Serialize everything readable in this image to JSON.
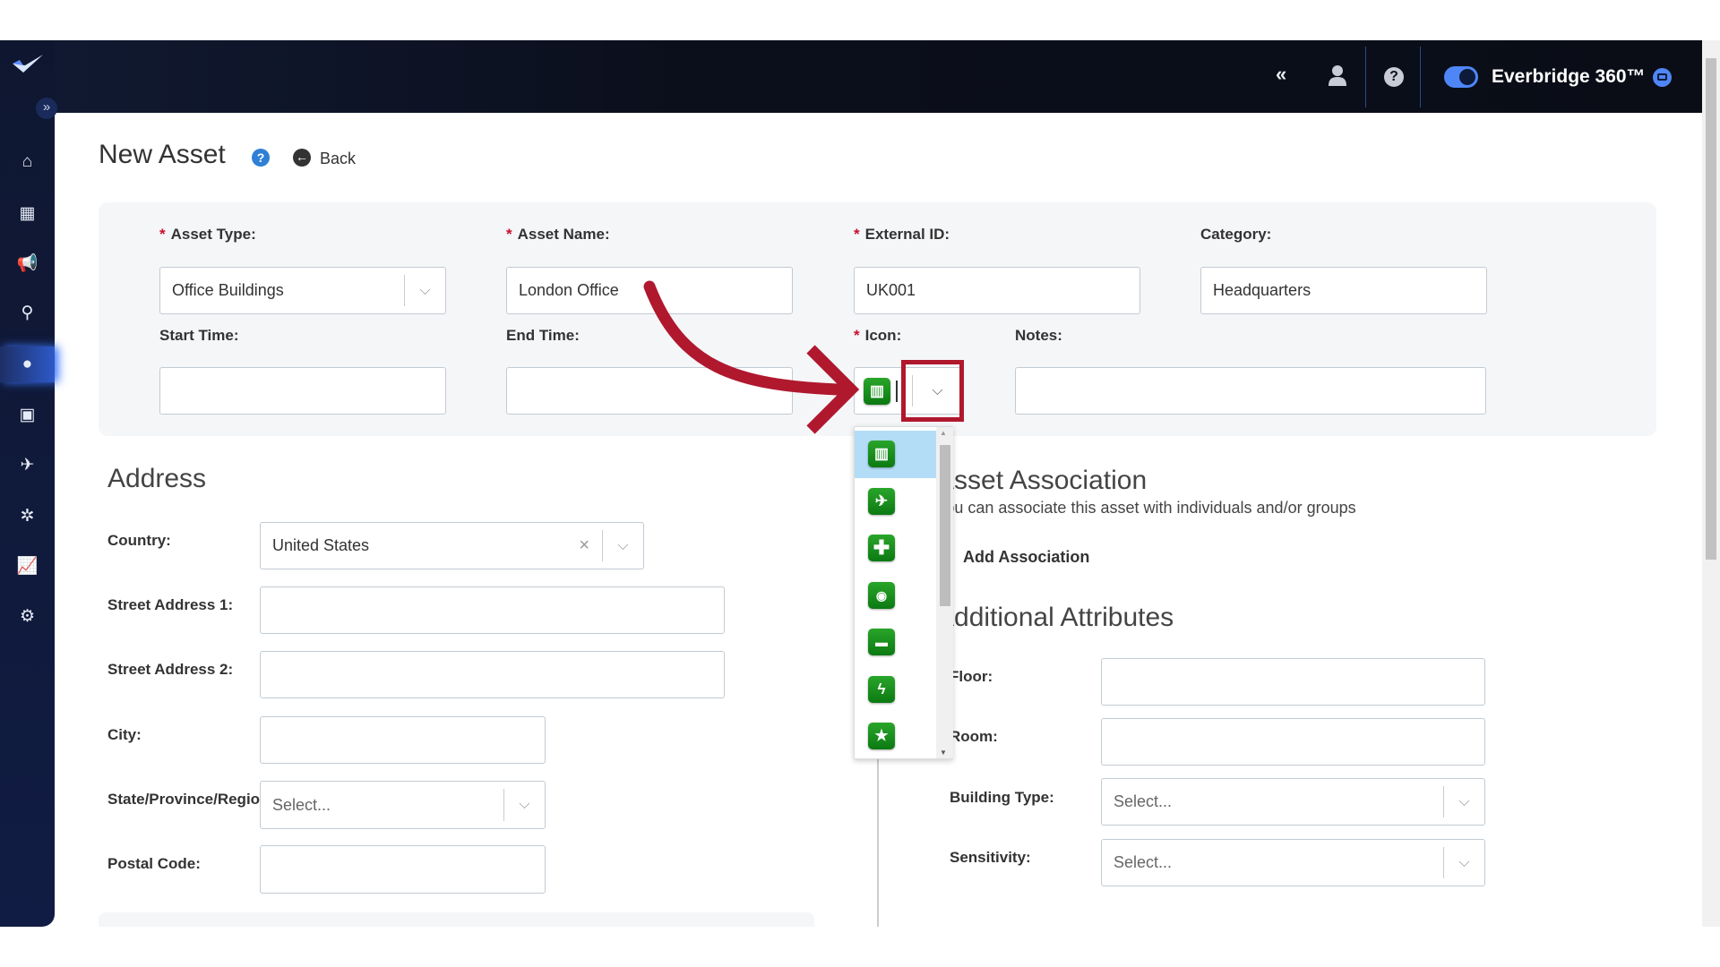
{
  "header": {
    "collapse_icon": "double-chevron-left",
    "brand": "Everbridge 360™",
    "toggle_on": true,
    "accent": "#4f86f7"
  },
  "sidebar": {
    "items": [
      "home",
      "map",
      "megaphone",
      "routes",
      "location-pin",
      "dashboard",
      "travel",
      "incidents",
      "analytics",
      "settings"
    ],
    "active": "location-pin"
  },
  "page": {
    "title": "New Asset",
    "back": "Back"
  },
  "form": {
    "asset_type": {
      "label": "Asset Type:",
      "value": "Office Buildings"
    },
    "asset_name": {
      "label": "Asset Name:",
      "value": "London Office"
    },
    "external_id": {
      "label": "External ID:",
      "value": "UK001"
    },
    "category": {
      "label": "Category:",
      "value": "Headquarters"
    },
    "start_time": {
      "label": "Start Time:",
      "value": ""
    },
    "end_time": {
      "label": "End Time:",
      "value": ""
    },
    "icon": {
      "label": "Icon:",
      "value": "office-building",
      "options": [
        "office-building",
        "airport",
        "hospital",
        "emergency-vehicle",
        "fire-truck",
        "power",
        "star"
      ]
    },
    "notes": {
      "label": "Notes:",
      "value": ""
    }
  },
  "address": {
    "title": "Address",
    "country": {
      "label": "Country:",
      "value": "United States"
    },
    "street1": {
      "label": "Street Address 1:",
      "value": ""
    },
    "street2": {
      "label": "Street Address 2:",
      "value": ""
    },
    "city": {
      "label": "City:",
      "value": ""
    },
    "state": {
      "label": "State/Province/Regio",
      "placeholder": "Select..."
    },
    "postal": {
      "label": "Postal Code:",
      "value": ""
    }
  },
  "association": {
    "title": "Asset Association",
    "subtitle": "You can associate this asset with individuals and/or groups",
    "add": "Add Association"
  },
  "attributes": {
    "title": "Additional Attributes",
    "floor": {
      "label": "Floor:",
      "value": ""
    },
    "room": {
      "label": "Room:",
      "value": ""
    },
    "building_type": {
      "label": "Building Type:",
      "placeholder": "Select..."
    },
    "sensitivity": {
      "label": "Sensitivity:",
      "placeholder": "Select..."
    }
  },
  "annotation_color": "#b0182e"
}
